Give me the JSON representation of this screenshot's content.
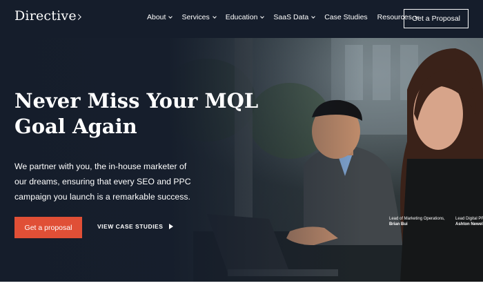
{
  "header": {
    "logo": "Directive",
    "nav": [
      {
        "label": "About",
        "dropdown": true
      },
      {
        "label": "Services",
        "dropdown": true
      },
      {
        "label": "Education",
        "dropdown": true
      },
      {
        "label": "SaaS Data",
        "dropdown": true
      },
      {
        "label": "Case Studies",
        "dropdown": false
      },
      {
        "label": "Resources",
        "dropdown": true
      }
    ],
    "cta": "Get a Proposal"
  },
  "hero": {
    "headline_lines": [
      "Never Miss Your MQL",
      "Goal Again"
    ],
    "intro_lines": [
      "We partner with you, the in-house marketer of",
      "our dreams, ensuring that every SEO and PPC",
      "campaign you launch is a remarkable success."
    ],
    "primary_button": "Get a proposal",
    "secondary_link": "VIEW CASE STUDIES",
    "captions": [
      {
        "role": "Lead of Marketing Operations,",
        "name": "Brian Bui"
      },
      {
        "role": "Lead Digital PR",
        "name": "Ashton Newell"
      }
    ]
  },
  "colors": {
    "header_bg": "#151d2b",
    "accent": "#e04f36",
    "text": "#ffffff"
  }
}
